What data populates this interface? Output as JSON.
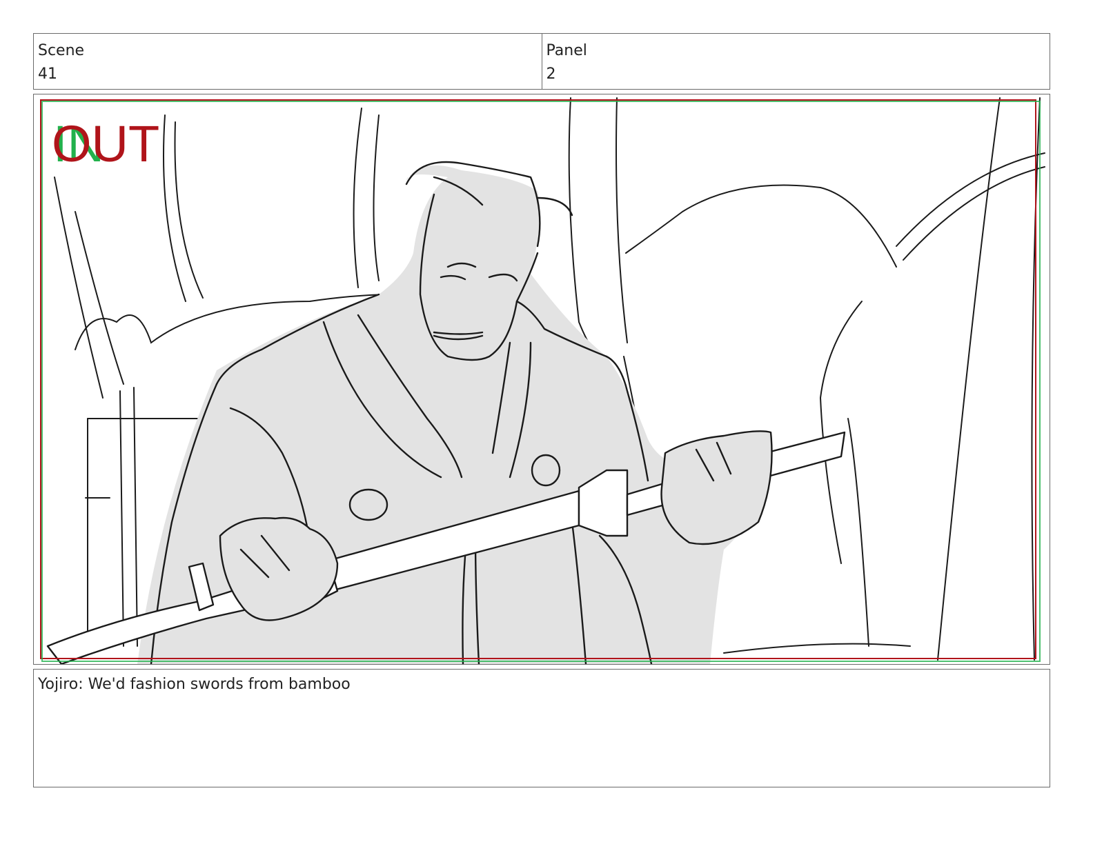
{
  "header": {
    "scene_label": "Scene",
    "scene_value": "41",
    "panel_label": "Panel",
    "panel_value": "2"
  },
  "frame": {
    "in_marker": "IN",
    "out_marker": "OUT",
    "in_color": "#22b14c",
    "out_color": "#b0141a",
    "sketch_fill": "#e3e3e3",
    "line_color": "#1a1a1a"
  },
  "caption": {
    "dialogue": "Yojiro: We'd fashion swords from bamboo"
  }
}
